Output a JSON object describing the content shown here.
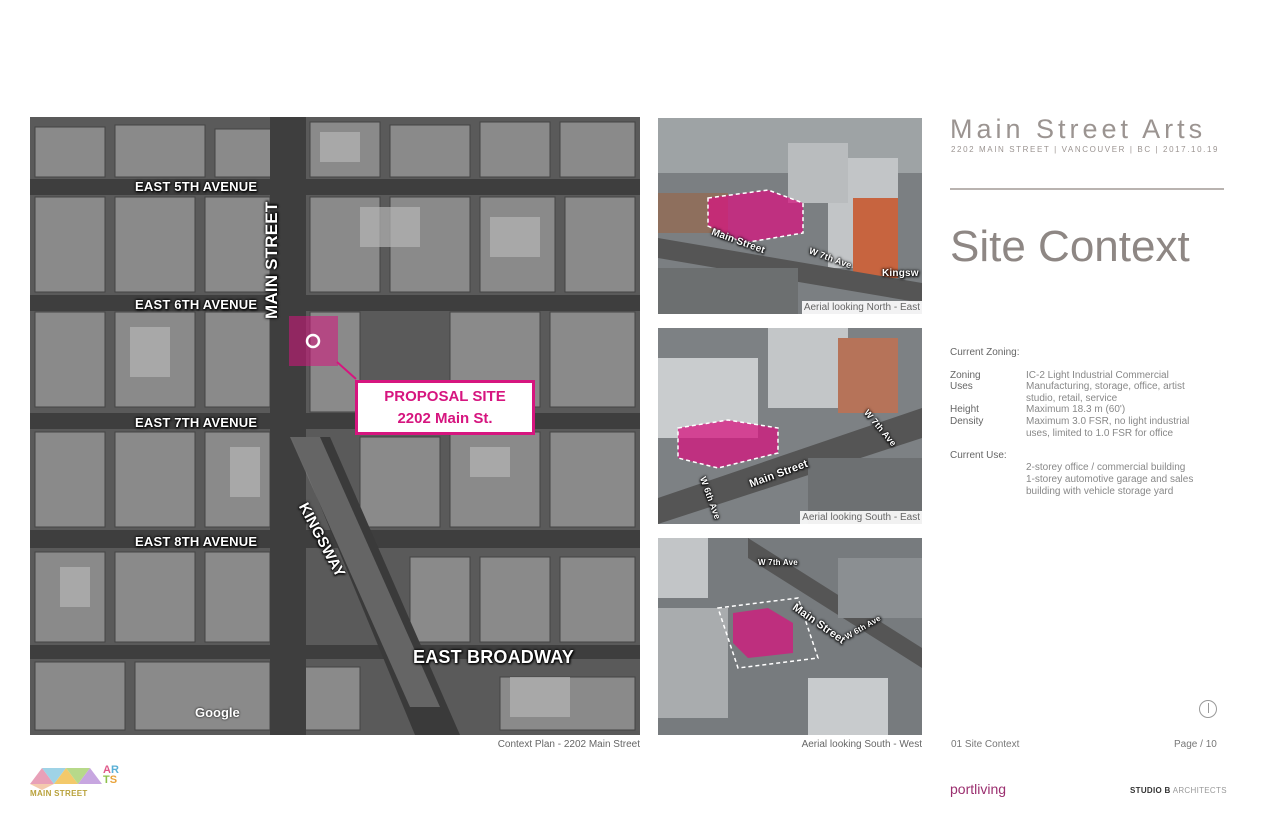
{
  "header": {
    "brand_title": "Main Street Arts",
    "brand_subtitle": "2202 MAIN STREET | VANCOUVER | BC | 2017.10.19",
    "section_title": "Site Context"
  },
  "map": {
    "street_labels": {
      "east_5th": "EAST 5TH AVENUE",
      "east_6th": "EAST 6TH AVENUE",
      "east_7th": "EAST 7TH AVENUE",
      "east_8th": "EAST 8TH AVENUE",
      "main_street": "MAIN STREET",
      "kingsway": "KINGSWAY",
      "east_broadway": "EAST BROADWAY"
    },
    "proposal_line1": "PROPOSAL SITE",
    "proposal_line2": "2202 Main St.",
    "google": "Google",
    "caption": "Context Plan - 2202 Main Street",
    "accent_color": "#d6157f"
  },
  "aerials": [
    {
      "caption": "Aerial looking North - East",
      "street_labels": [
        "Main Street",
        "W 7th Ave",
        "Kingsw"
      ]
    },
    {
      "caption": "Aerial looking South - East",
      "street_labels": [
        "Main Street",
        "W 6th Ave",
        "W 7th Ave"
      ]
    },
    {
      "caption": "Aerial looking South - West",
      "street_labels": [
        "Main Street",
        "W 7th Ave",
        "W 6th Ave"
      ]
    }
  ],
  "zoning": {
    "heading": "Current Zoning:",
    "rows": [
      {
        "label": "Zoning",
        "value": "IC-2 Light Industrial Commercial"
      },
      {
        "label": "Uses",
        "value": "Manufacturing, storage, office, artist studio, retail, service"
      },
      {
        "label": "Height",
        "value": "Maximum 18.3 m (60')"
      },
      {
        "label": "Density",
        "value": "Maximum 3.0 FSR, no light industrial uses, limited to 1.0 FSR for office"
      }
    ],
    "use_heading": "Current Use:",
    "use_lines": [
      "2-storey office / commercial building",
      "1-storey automotive garage and sales building with vehicle storage yard"
    ]
  },
  "footer": {
    "section": "01 Site Context",
    "page_label": "Page",
    "page_sep": "/",
    "page_number": "10",
    "client": "portliving",
    "architect_bold": "STUDIO B",
    "architect_light": "ARCHITECTS",
    "logo_text": "MAIN STREET",
    "logo_letters": [
      "A",
      "R",
      "T",
      "S"
    ]
  }
}
